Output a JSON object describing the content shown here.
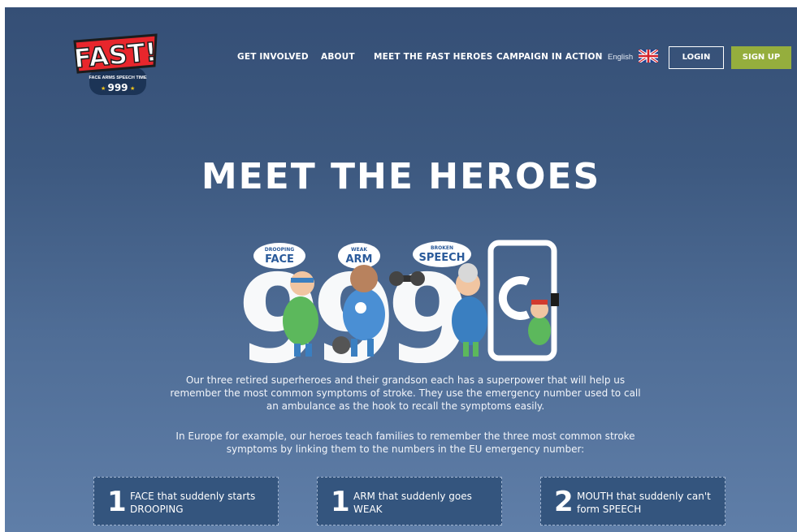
{
  "header": {
    "logo": {
      "title": "FAST!",
      "tagline": "FACE ARMS SPEECH TIME",
      "number": "999"
    },
    "nav": [
      "GET INVOLVED",
      "ABOUT",
      "MEET THE FAST HEROES",
      "CAMPAIGN IN ACTION"
    ],
    "language": "English",
    "flag_icon": "uk-flag-icon",
    "login_label": "LOGIN",
    "signup_label": "SIGN UP"
  },
  "hero": {
    "title": "MEET THE HEROES",
    "illustration": {
      "badges": [
        {
          "top": "DROOPING",
          "main": "FACE"
        },
        {
          "top": "WEAK",
          "main": "ARM"
        },
        {
          "top": "BROKEN",
          "main": "SPEECH"
        }
      ]
    },
    "paragraph1": "Our three retired superheroes and their grandson each has a superpower that will help us remember the most common symptoms of stroke. They use the emergency number used to call an ambulance as the hook to recall the symptoms easily.",
    "paragraph2": "In Europe for example, our heroes teach families to remember the three most common stroke symptoms by linking them to the numbers in the EU emergency number:"
  },
  "cards": [
    {
      "number": "1",
      "text": "FACE that suddenly starts DROOPING"
    },
    {
      "number": "1",
      "text": "ARM that suddenly goes WEAK"
    },
    {
      "number": "2",
      "text": "MOUTH that suddenly can't form SPEECH"
    }
  ],
  "colors": {
    "background_top": "#354f76",
    "background_bottom": "#5f7ea8",
    "signup": "#95ae3d",
    "logo_red": "#e8262c",
    "card": "#34557e"
  }
}
